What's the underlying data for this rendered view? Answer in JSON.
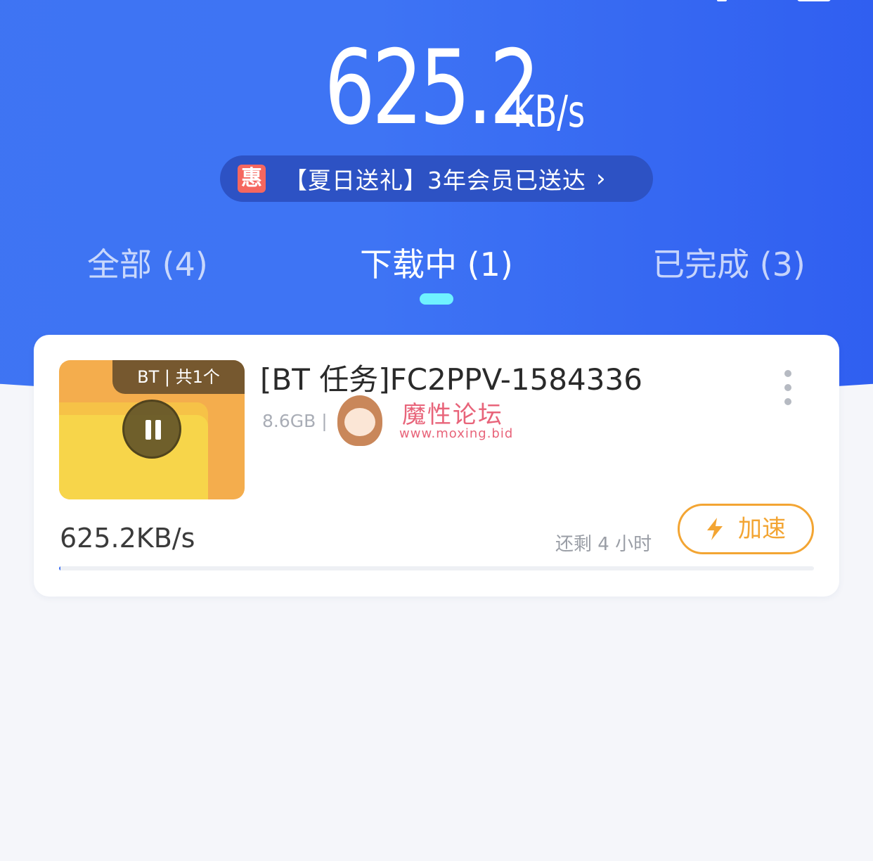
{
  "header": {
    "speed_value": "625.2",
    "speed_unit": "KB/s",
    "promo": {
      "badge": "惠",
      "text": "【夏日送礼】3年会员已送达",
      "chevron": "›"
    }
  },
  "tabs": [
    {
      "label": "全部 (4)",
      "active": false
    },
    {
      "label": "下载中 (1)",
      "active": true
    },
    {
      "label": "已完成 (3)",
      "active": false
    }
  ],
  "task": {
    "thumb_tag": "BT | 共1个",
    "title": "[BT 任务]FC2PPV-1584336",
    "meta": "8.6GB |",
    "speed": "625.2KB/s",
    "remaining": "还剩 4 小时",
    "boost_label": "加速",
    "progress": 0.002
  },
  "watermark": {
    "title": "魔性论坛",
    "url": "www.moxing.bid"
  },
  "colors": {
    "brand_blue": "#3e74f4",
    "tab_indicator": "#6ff2ff",
    "boost_orange": "#f3a533",
    "promo_badge": "#f5675f"
  },
  "icons": {
    "pause": "pause-icon",
    "more": "more-vertical-icon",
    "boost": "lightning-icon"
  }
}
